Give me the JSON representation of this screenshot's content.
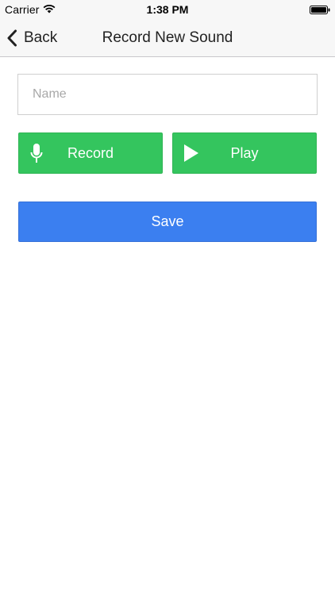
{
  "status_bar": {
    "carrier": "Carrier",
    "time": "1:38 PM",
    "icons": [
      "wifi-icon",
      "battery-icon"
    ]
  },
  "nav": {
    "back_label": "Back",
    "title": "Record New Sound",
    "back_icon": "chevron-left-icon"
  },
  "form": {
    "name_placeholder": "Name",
    "name_value": ""
  },
  "buttons": {
    "record_label": "Record",
    "record_icon": "microphone-icon",
    "play_label": "Play",
    "play_icon": "play-icon",
    "save_label": "Save"
  },
  "colors": {
    "record_button": "#34c55e",
    "play_button": "#34c55e",
    "save_button": "#3b7ff0",
    "nav_background": "#f7f7f7"
  }
}
